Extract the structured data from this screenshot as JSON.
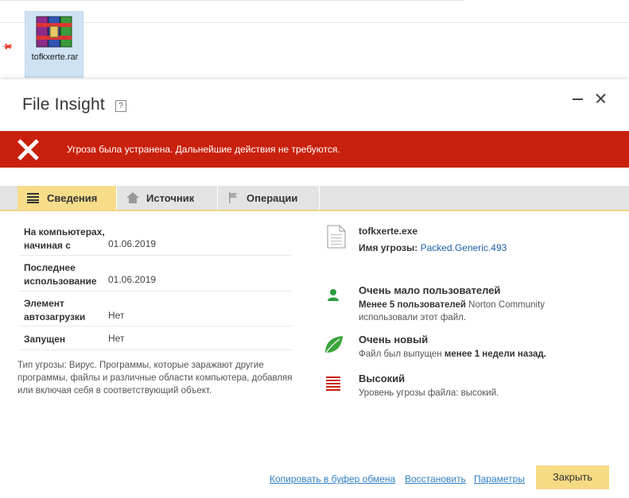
{
  "desktop": {
    "file_label": "tofkxerte.rar"
  },
  "dialog": {
    "title": "File Insight",
    "help": "?",
    "alert_text": "Угроза была устранена. Дальнейшие действия не требуются."
  },
  "tabs": [
    {
      "label": "Сведения",
      "icon": "list-icon",
      "active": true
    },
    {
      "label": "Источник",
      "icon": "home-icon",
      "active": false
    },
    {
      "label": "Операции",
      "icon": "flag-icon",
      "active": false
    }
  ],
  "details": [
    {
      "key": "На компьютерах, начиная с",
      "value": "01.06.2019"
    },
    {
      "key": "Последнее использование",
      "value": "01.06.2019"
    },
    {
      "key": "Элемент автозагрузки",
      "value": "Нет"
    },
    {
      "key": "Запущен",
      "value": "Нет"
    }
  ],
  "description": "Тип угрозы: Вирус. Программы, которые заражают другие программы, файлы и различные области компьютера, добавляя или включая себя в соответствующий объект.",
  "file": {
    "name": "tofkxerte.exe",
    "threat_label": "Имя угрозы:",
    "threat_name": "Packed.Generic.493"
  },
  "info": {
    "users": {
      "title": "Очень мало пользователей",
      "bold": "Менее 5 пользователей",
      "text1": " Norton Community",
      "text2": "использовали этот файл."
    },
    "age": {
      "title": "Очень новый",
      "text1": "Файл был выпущен ",
      "bold": "менее 1 недели назад."
    },
    "risk": {
      "title": "Высокий",
      "text": "Уровень угрозы файла: высокий."
    }
  },
  "footer": {
    "copy": "Копировать в буфер обмена",
    "restore": "Восстановить",
    "params": "Параметры",
    "close": "Закрыть"
  },
  "colors": {
    "alert": "#c8200c",
    "tab_active": "#f7dc8a",
    "button": "#f7da84",
    "link": "#2f7fc2",
    "user_icon": "#2a9c3f",
    "risk_icon": "#c8200c"
  }
}
